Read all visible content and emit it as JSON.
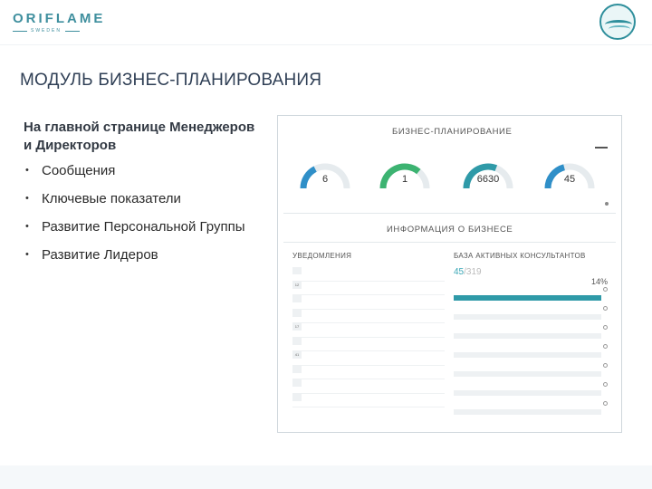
{
  "brand": {
    "name": "ORIFLAME",
    "sub": "SWEDEN"
  },
  "conference_logo": {
    "line1": "",
    "line2": ""
  },
  "page_title": "МОДУЛЬ БИЗНЕС-ПЛАНИРОВАНИЯ",
  "subheading": "На главной странице Менеджеров и Директоров",
  "bullets": [
    "Сообщения",
    "Ключевые показатели",
    "Развитие Персональной Группы",
    "Развитие Лидеров"
  ],
  "screenshot": {
    "bp_title": "БИЗНЕС-ПЛАНИРОВАНИЕ",
    "legend_top": "",
    "gauges": [
      {
        "value": "6",
        "fraction": 0.35,
        "color": "#2f8fc8"
      },
      {
        "value": "1",
        "fraction": 0.72,
        "color": "#3cb371"
      },
      {
        "value": "6630",
        "fraction": 0.62,
        "color": "#2f9aa8"
      },
      {
        "value": "45",
        "fraction": 0.42,
        "color": "#2f8fc8"
      }
    ],
    "legend_bottom": "",
    "ib_title": "ИНФОРМАЦИЯ О БИЗНЕСЕ",
    "notifications": {
      "title": "УВЕДОМЛЕНИЯ",
      "link": "",
      "items": [
        {
          "num": "",
          "text": ""
        },
        {
          "num": "12",
          "text": ""
        },
        {
          "num": "",
          "text": ""
        },
        {
          "num": "",
          "text": ""
        },
        {
          "num": "17",
          "text": ""
        },
        {
          "num": "",
          "text": ""
        },
        {
          "num": "41",
          "text": ""
        },
        {
          "num": "",
          "text": ""
        },
        {
          "num": "",
          "text": ""
        },
        {
          "num": "",
          "text": ""
        }
      ]
    },
    "base": {
      "title": "БАЗА АКТИВНЫХ КОНСУЛЬТАНТОВ",
      "small": "",
      "big_value": "45",
      "big_grey": "/319",
      "percent": "14%",
      "bars": [
        {
          "label": "",
          "fill": 1.0
        },
        {
          "label": "",
          "fill": 0.0
        },
        {
          "label": "",
          "fill": 0.0
        },
        {
          "label": "",
          "fill": 0.0
        },
        {
          "label": "",
          "fill": 0.0
        },
        {
          "label": "",
          "fill": 0.0
        },
        {
          "label": "",
          "fill": 0.0
        }
      ]
    }
  }
}
